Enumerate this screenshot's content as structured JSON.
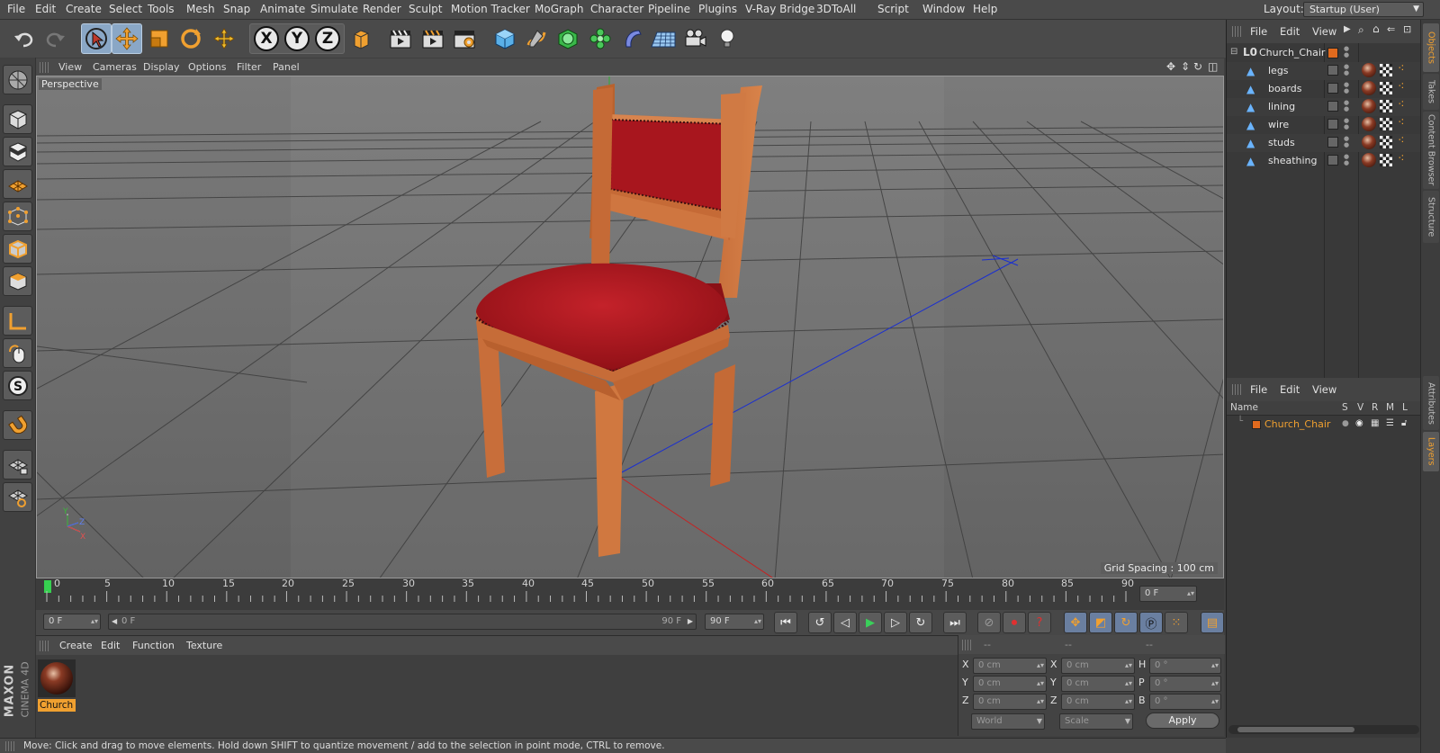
{
  "menubar": {
    "items": [
      "File",
      "Edit",
      "Create",
      "Select",
      "Tools",
      "Mesh",
      "Snap",
      "Animate",
      "Simulate",
      "Render",
      "Sculpt",
      "Motion Tracker",
      "MoGraph",
      "Character",
      "Pipeline",
      "Plugins",
      "V-Ray Bridge",
      "3DToAll",
      "Script",
      "Window",
      "Help"
    ],
    "layout_label": "Layout:",
    "layout_value": "Startup (User)"
  },
  "toolbar": {
    "axis_x": "X",
    "axis_y": "Y",
    "axis_z": "Z"
  },
  "viewport": {
    "menu": [
      "View",
      "Cameras",
      "Display",
      "Options",
      "Filter",
      "Panel"
    ],
    "label": "Perspective",
    "grid_spacing": "Grid Spacing : 100 cm",
    "axis_labels": {
      "x": "X",
      "y": "Y",
      "z": "Z"
    }
  },
  "timeline": {
    "ticks": [
      "0",
      "5",
      "10",
      "15",
      "20",
      "25",
      "30",
      "35",
      "40",
      "45",
      "50",
      "55",
      "60",
      "65",
      "70",
      "75",
      "80",
      "85",
      "90"
    ],
    "current_frame_field": "0 F"
  },
  "transport": {
    "start_field": "0 F",
    "range_left": "0 F",
    "range_right": "90 F",
    "end_field": "90 F"
  },
  "material_panel": {
    "menu": [
      "Create",
      "Edit",
      "Function",
      "Texture"
    ],
    "material_name": "Church"
  },
  "coord_panel": {
    "headers": [
      "--",
      "--",
      "--"
    ],
    "rows": [
      {
        "l1": "X",
        "v1": "0 cm",
        "l2": "X",
        "v2": "0 cm",
        "l3": "H",
        "v3": "0 °"
      },
      {
        "l1": "Y",
        "v1": "0 cm",
        "l2": "Y",
        "v2": "0 cm",
        "l3": "P",
        "v3": "0 °"
      },
      {
        "l1": "Z",
        "v1": "0 cm",
        "l2": "Z",
        "v2": "0 cm",
        "l3": "B",
        "v3": "0 °"
      }
    ],
    "space_select": "World",
    "mode_select": "Scale",
    "apply_label": "Apply"
  },
  "status": {
    "text": "Move: Click and drag to move elements. Hold down SHIFT to quantize movement / add to the selection in point mode, CTRL to remove."
  },
  "object_manager": {
    "menu": [
      "File",
      "Edit",
      "View"
    ],
    "root": "Church_Chair",
    "children": [
      "legs",
      "boards",
      "lining",
      "wire",
      "studs",
      "sheathing"
    ]
  },
  "layer_manager": {
    "menu": [
      "File",
      "Edit",
      "View"
    ],
    "columns": [
      "Name",
      "S",
      "V",
      "R",
      "M",
      "L"
    ],
    "rows": [
      {
        "name": "Church_Chair",
        "color": "#e06a1e"
      }
    ]
  },
  "side_tabs": [
    "Objects",
    "Takes",
    "Content Browser",
    "Structure",
    "Attributes",
    "Layers"
  ],
  "brand": {
    "maxon": "MAXON",
    "product": "CINEMA 4D"
  },
  "colors": {
    "accent": "#f0a030",
    "layer_color": "#e06a1e",
    "selection_blue": "#8aa7c6"
  }
}
